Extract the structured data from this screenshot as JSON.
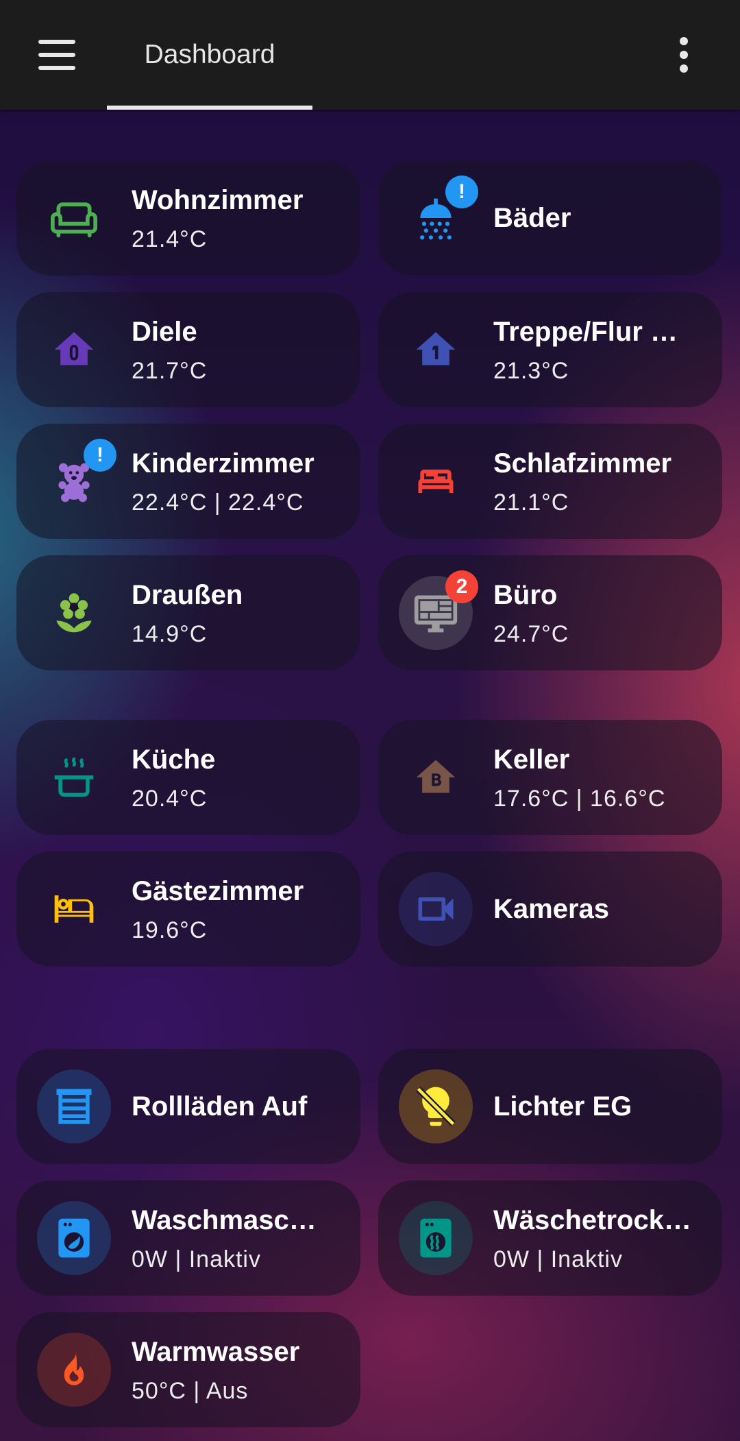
{
  "header": {
    "tab_label": "Dashboard"
  },
  "cards": [
    {
      "name": "Wohnzimmer",
      "state": "21.4°C",
      "icon": "sofa-icon",
      "icon_color": "#4caf50"
    },
    {
      "name": "Bäder",
      "state": "",
      "icon": "shower-icon",
      "icon_color": "#2196f3",
      "badge": "!"
    },
    {
      "name": "Diele",
      "state": "21.7°C",
      "icon": "home-floor-0-icon",
      "icon_color": "#673ab7"
    },
    {
      "name": "Treppe/Flur O…",
      "state": "21.3°C",
      "icon": "home-floor-1-icon",
      "icon_color": "#3f51b5"
    },
    {
      "name": "Kinderzimmer",
      "state": "22.4°C | 22.4°C",
      "icon": "teddy-bear-icon",
      "icon_color": "#9c6fd6",
      "badge": "!"
    },
    {
      "name": "Schlafzimmer",
      "state": "21.1°C",
      "icon": "bed-icon",
      "icon_color": "#f44336"
    },
    {
      "name": "Draußen",
      "state": "14.9°C",
      "icon": "flower-icon",
      "icon_color": "#8bc34a"
    },
    {
      "name": "Büro",
      "state": "24.7°C",
      "icon": "monitor-dashboard-icon",
      "icon_color": "#9e9e9e",
      "badge": "2"
    },
    {
      "name": "Küche",
      "state": "20.4°C",
      "icon": "pot-steam-icon",
      "icon_color": "#009688"
    },
    {
      "name": "Keller",
      "state": "17.6°C | 16.6°C",
      "icon": "home-floor-b-icon",
      "icon_color": "#795548"
    },
    {
      "name": "Gästezimmer",
      "state": "19.6°C",
      "icon": "bed-empty-icon",
      "icon_color": "#ffc107"
    },
    {
      "name": "Kameras",
      "state": "",
      "icon": "video-icon",
      "icon_color": "#3f51b5"
    },
    {
      "name": "Rollläden Auf",
      "state": "",
      "icon": "window-shutter-icon",
      "icon_color": "#2196f3"
    },
    {
      "name": "Lichter EG",
      "state": "",
      "icon": "lightbulb-off-icon",
      "icon_color": "#ffeb3b"
    },
    {
      "name": "Waschmaschi…",
      "state": "0W | Inaktiv",
      "icon": "washing-machine-icon",
      "icon_color": "#2196f3"
    },
    {
      "name": "Wäschetrockn…",
      "state": "0W | Inaktiv",
      "icon": "tumble-dryer-icon",
      "icon_color": "#009688"
    },
    {
      "name": "Warmwasser",
      "state": "50°C | Aus",
      "icon": "fire-icon",
      "icon_color": "#ff5722"
    }
  ]
}
